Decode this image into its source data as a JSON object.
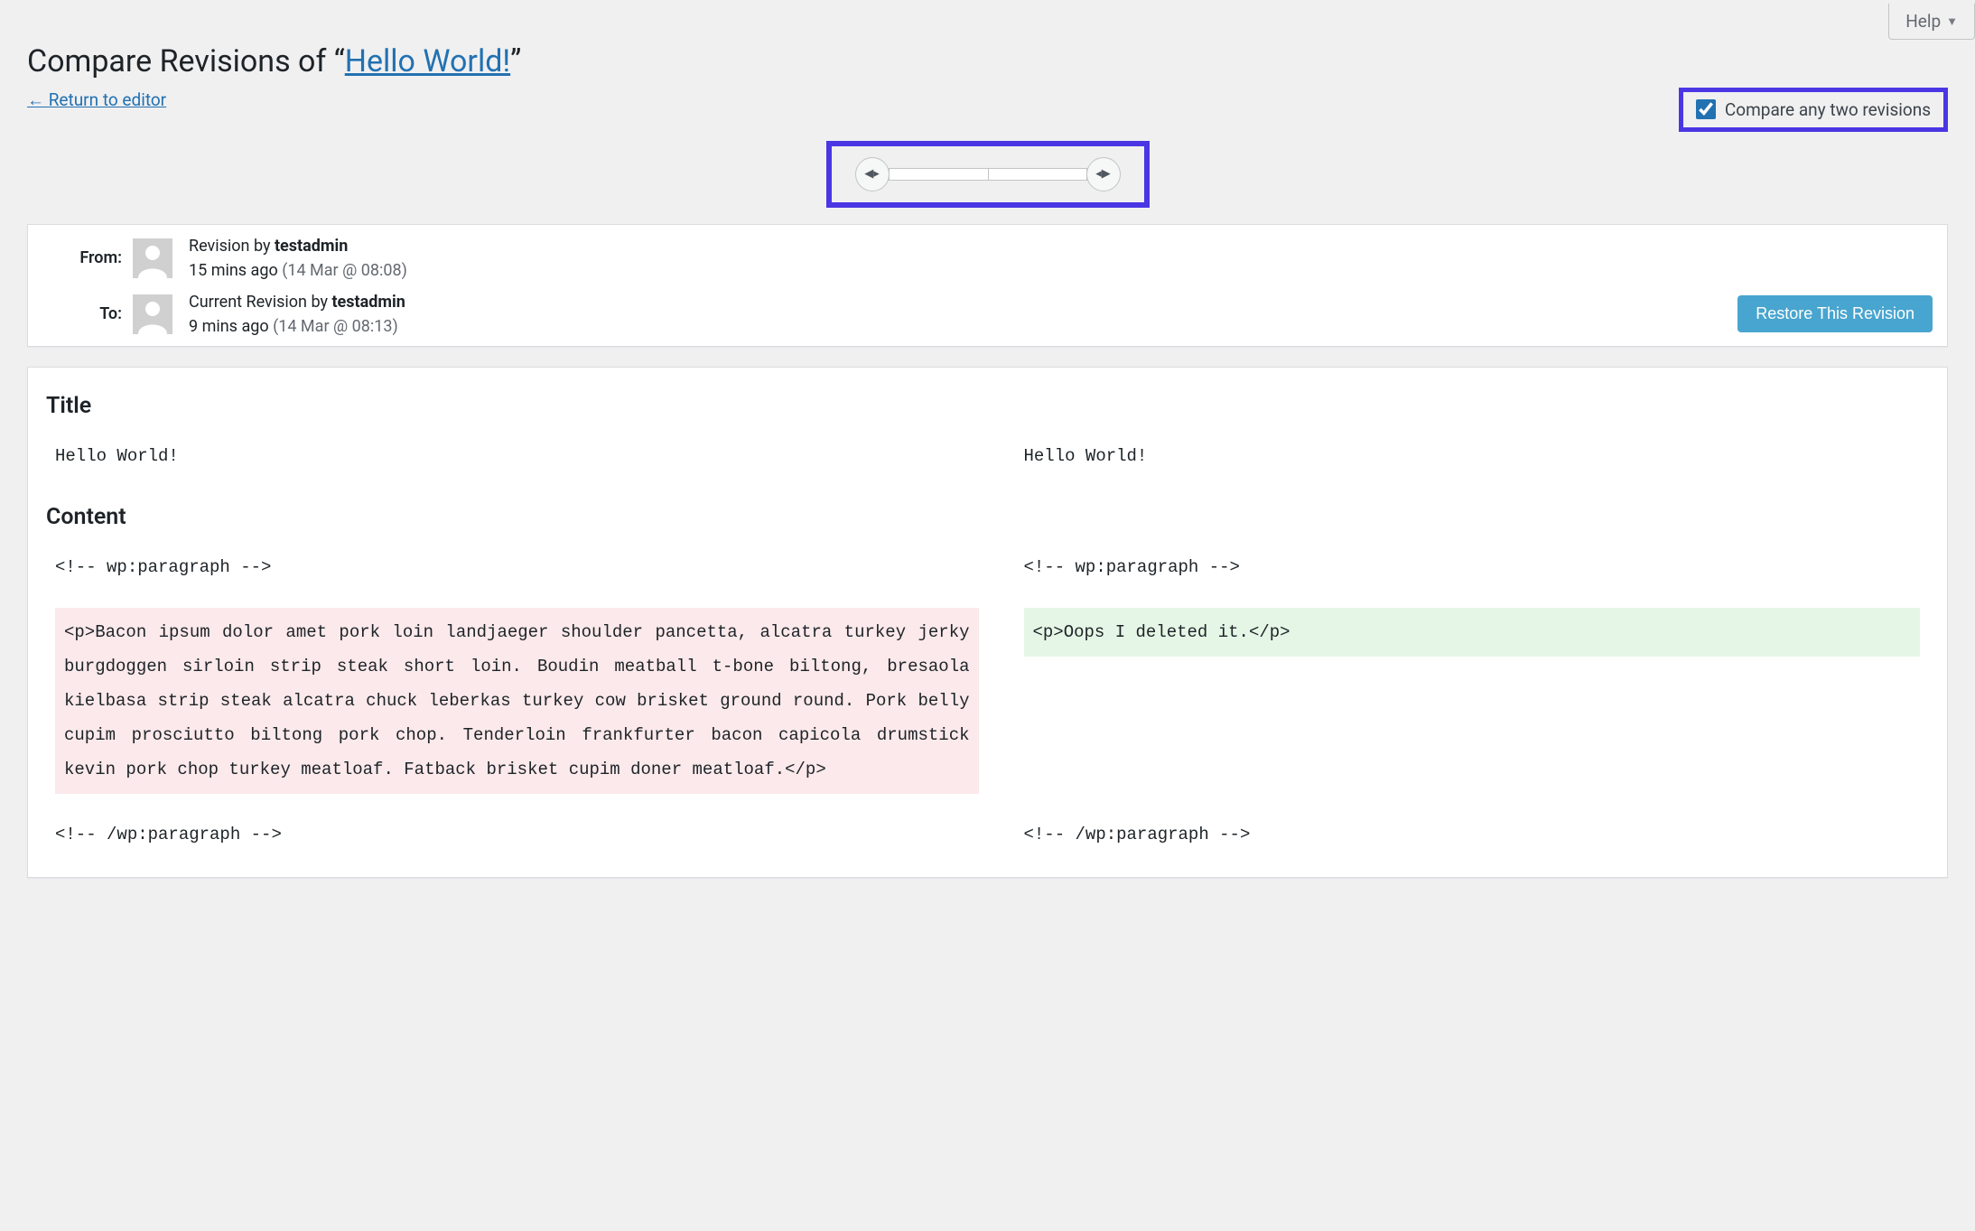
{
  "help_tab": {
    "label": "Help"
  },
  "heading": {
    "prefix": "Compare Revisions of “",
    "link": "Hello World!",
    "suffix": "”"
  },
  "return_link": "← Return to editor",
  "compare_toggle": {
    "checked": true,
    "label": "Compare any two revisions"
  },
  "meta": {
    "from": {
      "label": "From:",
      "line1_prefix": "Revision by ",
      "author": "testadmin",
      "ago": "15 mins ago",
      "stamp": "(14 Mar @ 08:08)"
    },
    "to": {
      "label": "To:",
      "line1_prefix": "Current Revision by ",
      "author": "testadmin",
      "ago": "9 mins ago",
      "stamp": "(14 Mar @ 08:13)"
    },
    "restore_btn": "Restore This Revision"
  },
  "diff": {
    "title_heading": "Title",
    "title_left": "Hello World!",
    "title_right": "Hello World!",
    "content_heading": "Content",
    "open_left": "<!-- wp:paragraph -->",
    "open_right": "<!-- wp:paragraph -->",
    "body_left": "<p>Bacon ipsum dolor amet pork loin landjaeger shoulder pancetta, alcatra turkey jerky burgdoggen sirloin strip steak short loin. Boudin meatball t-bone biltong, bresaola kielbasa strip steak alcatra chuck leberkas turkey cow brisket ground round. Pork belly cupim prosciutto biltong pork chop. Tenderloin frankfurter bacon capicola drumstick kevin pork chop turkey meatloaf. Fatback brisket cupim doner meatloaf.</p>",
    "body_right": "<p>Oops I deleted it.</p>",
    "close_left": "<!-- /wp:paragraph -->",
    "close_right": "<!-- /wp:paragraph -->"
  }
}
